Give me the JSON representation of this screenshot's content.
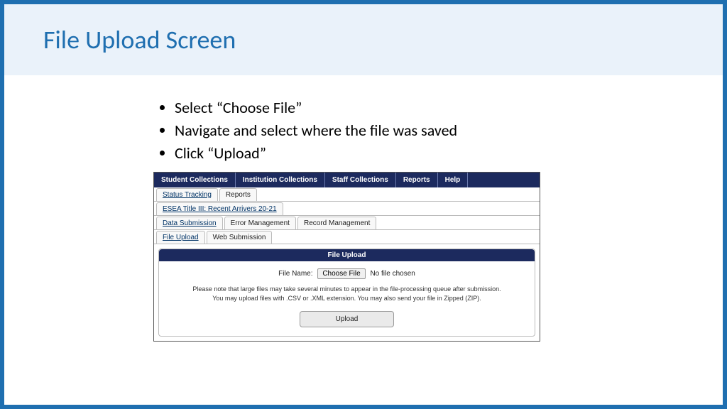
{
  "title": "File Upload Screen",
  "bullets": [
    "Select “Choose File”",
    "Navigate and select where the file was saved",
    "Click “Upload”"
  ],
  "app": {
    "nav": [
      "Student Collections",
      "Institution Collections",
      "Staff Collections",
      "Reports",
      "Help"
    ],
    "row1": [
      "Status Tracking",
      "Reports"
    ],
    "row2": [
      "ESEA Title III: Recent Arrivers 20-21"
    ],
    "row3": [
      "Data Submission",
      "Error Management",
      "Record Management"
    ],
    "row4": [
      "File Upload",
      "Web Submission"
    ],
    "panel": {
      "header": "File Upload",
      "fileNameLabel": "File Name:",
      "chooseFile": "Choose File",
      "noFileChosen": "No file chosen",
      "noteLine1": "Please note that large files may take several minutes to appear in the file-processing queue after submission.",
      "noteLine2": "You may upload files with .CSV or .XML extension. You may also send your file in Zipped (ZIP).",
      "uploadLabel": "Upload"
    }
  }
}
